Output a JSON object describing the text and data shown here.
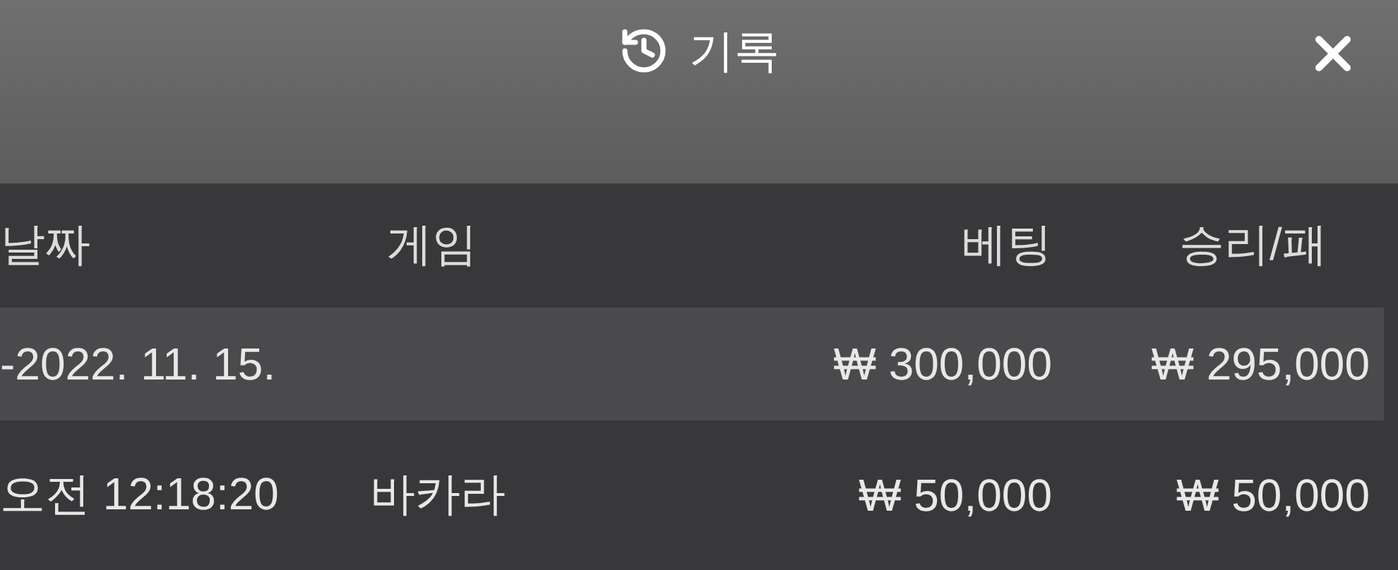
{
  "header": {
    "title": "기록"
  },
  "table": {
    "columns": [
      "날짜",
      "게임",
      "베팅",
      "승리/패"
    ],
    "summary": {
      "date": "-2022. 11. 15.",
      "bet": "₩ 300,000",
      "win": "₩ 295,000"
    },
    "rows": [
      {
        "date": "오전 12:18:20",
        "game": "바카라",
        "bet": "₩ 50,000",
        "win": "₩ 50,000"
      }
    ]
  }
}
